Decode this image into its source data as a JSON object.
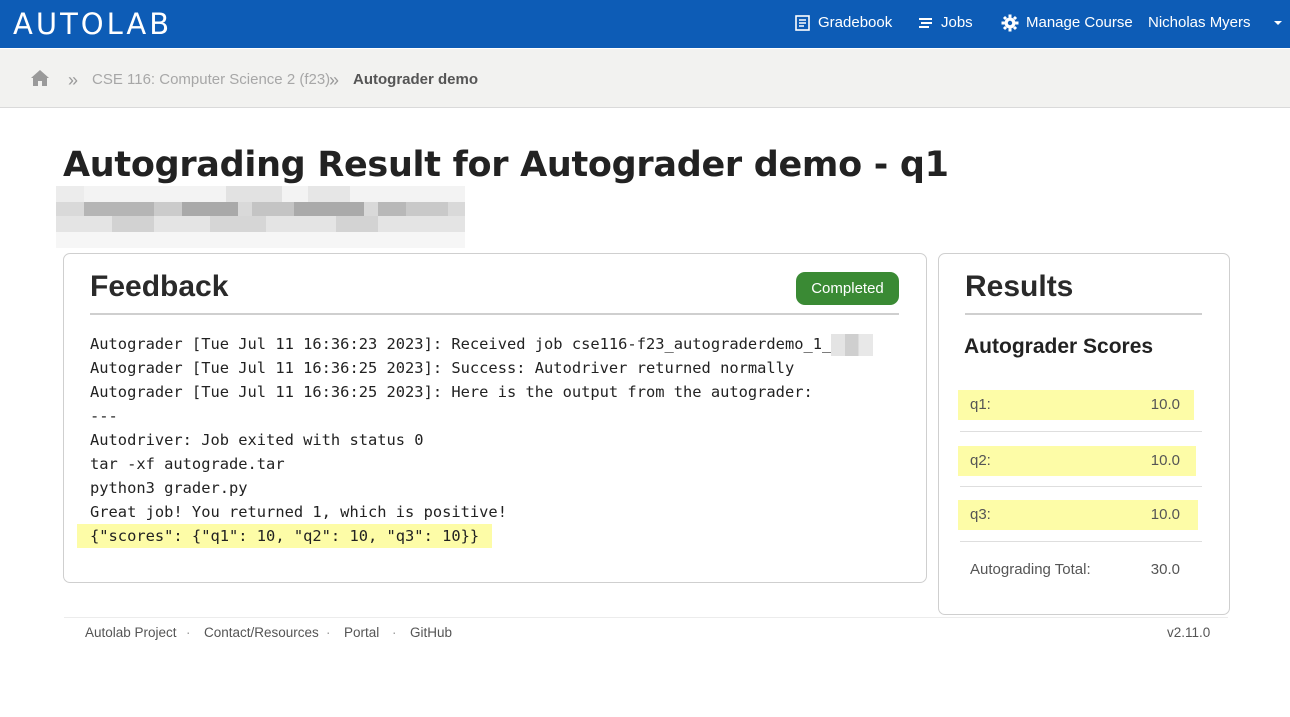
{
  "app": {
    "logo": "AUTOLAB"
  },
  "nav": {
    "gradebook": "Gradebook",
    "jobs": "Jobs",
    "manage": "Manage Course",
    "user": "Nicholas Myers"
  },
  "breadcrumb": {
    "home_icon": "home-icon",
    "course": "CSE 116: Computer Science 2 (f23)",
    "current": "Autograder demo",
    "separator": "»"
  },
  "page": {
    "title": "Autograding Result for Autograder demo - q1"
  },
  "feedback": {
    "title": "Feedback",
    "status": "Completed",
    "lines": [
      "Autograder [Tue Jul 11 16:36:23 2023]: Received job cse116-f23_autograderdemo_1_",
      "Autograder [Tue Jul 11 16:36:25 2023]: Success: Autodriver returned normally",
      "Autograder [Tue Jul 11 16:36:25 2023]: Here is the output from the autograder:",
      "---",
      "Autodriver: Job exited with status 0",
      "tar -xf autograde.tar",
      "python3 grader.py",
      "Great job! You returned 1, which is positive!",
      "{\"scores\": {\"q1\": 10, \"q2\": 10, \"q3\": 10}}"
    ]
  },
  "results": {
    "title": "Results",
    "subtitle": "Autograder Scores",
    "scores": [
      {
        "label": "q1:",
        "value": "10.0"
      },
      {
        "label": "q2:",
        "value": "10.0"
      },
      {
        "label": "q3:",
        "value": "10.0"
      }
    ],
    "total_label": "Autograding Total:",
    "total_value": "30.0"
  },
  "footer": {
    "links": [
      "Autolab Project",
      "Contact/Resources",
      "Portal",
      "GitHub"
    ],
    "separator": "·",
    "version": "v2.11.0"
  },
  "colors": {
    "header": "#0d5cb6",
    "badge": "#3a8a34",
    "highlight": "#fdfca7"
  }
}
